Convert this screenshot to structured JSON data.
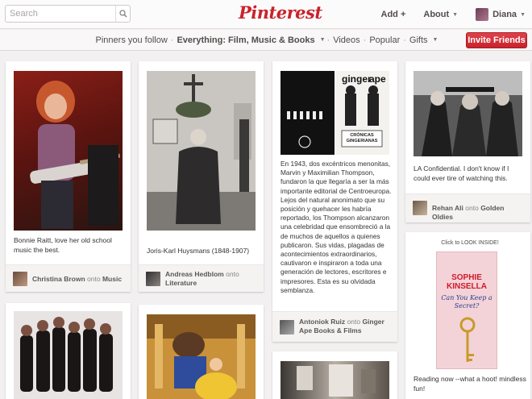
{
  "header": {
    "search_placeholder": "Search",
    "logo": "Pinterest",
    "add_label": "Add +",
    "about_label": "About",
    "user_label": "Diana"
  },
  "subnav": {
    "pinners": "Pinners you follow",
    "everything": "Everything: Film, Music & Books",
    "videos": "Videos",
    "popular": "Popular",
    "gifts": "Gifts",
    "invite": "Invite Friends"
  },
  "pins": {
    "raitt": {
      "desc": "Bonnie Raitt, love her old school music the best.",
      "user": "Christina Brown",
      "onto": "onto",
      "board": "Music"
    },
    "huysmans": {
      "desc": "Joris-Karl Huysmans (1848-1907)",
      "user": "Andreas Hedblom",
      "onto": "onto",
      "board": "Literature"
    },
    "ginger": {
      "book_title1": "ginger",
      "book_title2": "ape",
      "book_sub": "CRÓNICAS GINGERIANAS",
      "desc": "En 1943, dos excéntricos menonitas, Marvin y Maximilian Thompson, fundaron la que llegaría a ser la más importante editorial de Centroeuropa. Lejos del natural anonimato que su posición y quehacer les habría reportado, los Thompson alcanzaron una celebridad que ensombreció a la de muchos de aquellos a quienes publicaron. Sus vidas, plagadas de acontecimientos extraordinarios, cautivaron e inspiraron a toda una generación de lectores, escritores e impresores. Esta es su olvidada semblanza.",
      "user": "Antoniok Ruiz",
      "onto": "onto",
      "board": "Ginger Ape Books & Films"
    },
    "la": {
      "desc": "LA Confidential. I don't know if I could ever tire of watching this.",
      "user": "Rehan Ali",
      "onto": "onto",
      "board": "Golden Oldies"
    },
    "kinsella": {
      "click_label": "Click to LOOK INSIDE!",
      "author": "SOPHIE KINSELLA",
      "title": "Can You Keep a Secret?",
      "desc": "Reading now --what a hoot! mindless fun!"
    }
  },
  "colors": {
    "brand": "#c8232c",
    "background": "#f2f0f0"
  }
}
